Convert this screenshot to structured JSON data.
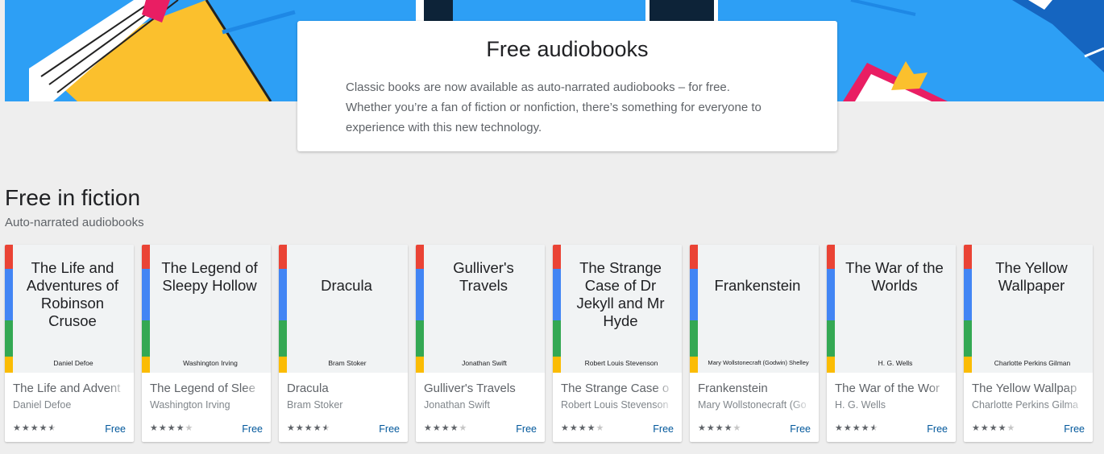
{
  "intro": {
    "title": "Free audiobooks",
    "line1": "Classic books are now available as auto-narrated audiobooks – for free.",
    "line2": "Whether you’re a fan of fiction or nonfiction, there’s something for everyone to",
    "line3": "experience with this new technology."
  },
  "section": {
    "title": "Free in fiction",
    "subtitle": "Auto-narrated audiobooks"
  },
  "colors": {
    "hero_blue": "#2d9ff5",
    "spine_red": "#ea4335",
    "spine_blue": "#4285f4",
    "spine_green": "#34a853",
    "spine_yellow": "#fbbc04",
    "price": "#01579b"
  },
  "books": [
    {
      "cover_title": "The Life and Adventures of Robinson Crusoe",
      "cover_author": "Daniel Defoe",
      "title": "The Life and Advent",
      "author": "Daniel Defoe",
      "rating": 4.5,
      "price": "Free"
    },
    {
      "cover_title": "The Legend of Sleepy Hollow",
      "cover_author": "Washington Irving",
      "title": "The Legend of Slee",
      "author": "Washington Irving",
      "rating": 4,
      "price": "Free"
    },
    {
      "cover_title": "Dracula",
      "cover_author": "Bram Stoker",
      "title": "Dracula",
      "author": "Bram Stoker",
      "rating": 4.5,
      "price": "Free"
    },
    {
      "cover_title": "Gulliver's Travels",
      "cover_author": "Jonathan Swift",
      "title": "Gulliver's Travels",
      "author": "Jonathan Swift",
      "rating": 4,
      "price": "Free"
    },
    {
      "cover_title": "The Strange Case of Dr Jekyll and Mr Hyde",
      "cover_author": "Robert Louis Stevenson",
      "title": "The Strange Case o",
      "author": "Robert Louis Stevenson",
      "rating": 4,
      "price": "Free"
    },
    {
      "cover_title": "Frankenstein",
      "cover_author": "Mary Wollstonecraft (Godwin) Shelley",
      "title": "Frankenstein",
      "author": "Mary Wollstonecraft (Go",
      "rating": 4,
      "price": "Free"
    },
    {
      "cover_title": "The War of the Worlds",
      "cover_author": "H. G. Wells",
      "title": "The War of the Wor",
      "author": "H. G. Wells",
      "rating": 4.5,
      "price": "Free"
    },
    {
      "cover_title": "The Yellow Wallpaper",
      "cover_author": "Charlotte Perkins Gilman",
      "title": "The Yellow Wallpap",
      "author": "Charlotte Perkins Gilma",
      "rating": 4,
      "price": "Free"
    }
  ]
}
